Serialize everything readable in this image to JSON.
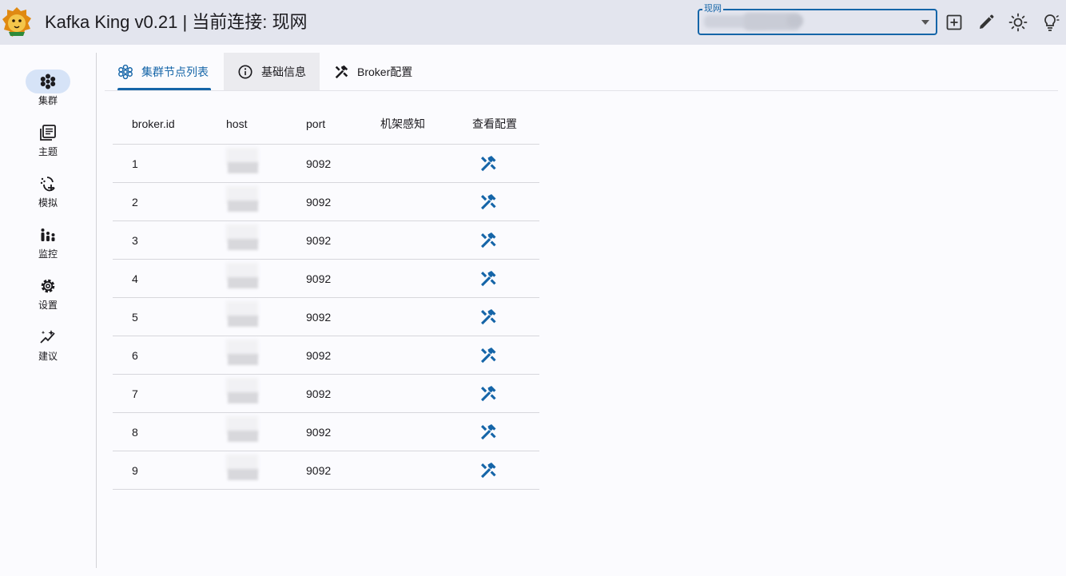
{
  "app": {
    "title": "Kafka King v0.21 | 当前连接: 现网"
  },
  "header": {
    "connection_label": "现网",
    "connection_value": "",
    "icons": [
      "add-square-icon",
      "edit-pencil-icon",
      "sun-theme-icon",
      "lightbulb-icon"
    ]
  },
  "sidebar": {
    "items": [
      {
        "label": "集群",
        "icon": "cluster-icon",
        "active": true
      },
      {
        "label": "主题",
        "icon": "topic-list-icon",
        "active": false
      },
      {
        "label": "模拟",
        "icon": "simulate-icon",
        "active": false
      },
      {
        "label": "监控",
        "icon": "monitor-icon",
        "active": false
      },
      {
        "label": "设置",
        "icon": "settings-gear-icon",
        "active": false
      },
      {
        "label": "建议",
        "icon": "suggest-sparkle-icon",
        "active": false
      }
    ]
  },
  "tabs": [
    {
      "label": "集群节点列表",
      "icon": "cluster-icon",
      "active": true
    },
    {
      "label": "基础信息",
      "icon": "info-icon",
      "active": false
    },
    {
      "label": "Broker配置",
      "icon": "tools-icon",
      "active": false
    }
  ],
  "table": {
    "headers": [
      "broker.id",
      "host",
      "port",
      "机架感知",
      "查看配置"
    ],
    "rows": [
      {
        "id": "1",
        "host": "",
        "port": "9092",
        "rack": ""
      },
      {
        "id": "2",
        "host": "",
        "port": "9092",
        "rack": ""
      },
      {
        "id": "3",
        "host": "",
        "port": "9092",
        "rack": ""
      },
      {
        "id": "4",
        "host": "",
        "port": "9092",
        "rack": ""
      },
      {
        "id": "5",
        "host": "",
        "port": "9092",
        "rack": ""
      },
      {
        "id": "6",
        "host": "",
        "port": "9092",
        "rack": ""
      },
      {
        "id": "7",
        "host": "",
        "port": "9092",
        "rack": ""
      },
      {
        "id": "8",
        "host": "",
        "port": "9092",
        "rack": ""
      },
      {
        "id": "9",
        "host": "",
        "port": "9092",
        "rack": ""
      }
    ]
  },
  "colors": {
    "accent": "#1565a8",
    "titlebar_bg": "#e3e5ee",
    "active_pill": "#d6e3f7",
    "page_bg": "#fbfbfe"
  }
}
